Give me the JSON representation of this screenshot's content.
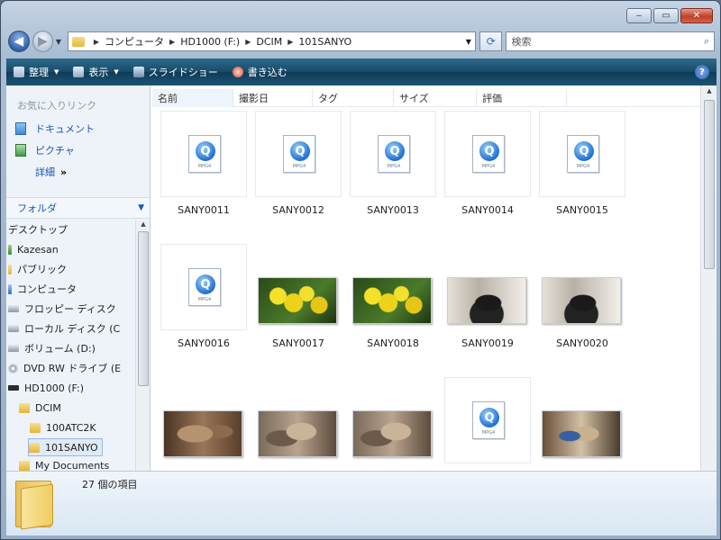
{
  "address": {
    "crumbs": [
      "コンピュータ",
      "HD1000 (F:)",
      "DCIM",
      "101SANYO"
    ]
  },
  "search": {
    "placeholder": "検索"
  },
  "toolbar": {
    "organize": "整理",
    "view": "表示",
    "slideshow": "スライドショー",
    "burn": "書き込む"
  },
  "favorites": {
    "title": "お気に入りリンク",
    "items": [
      "ドキュメント",
      "ピクチャ"
    ],
    "more": "詳細"
  },
  "folders_header": "フォルダ",
  "tree": [
    {
      "label": "デスクトップ",
      "icon": "desktop"
    },
    {
      "label": "Kazesan",
      "icon": "user-folder"
    },
    {
      "label": "パブリック",
      "icon": "folder"
    },
    {
      "label": "コンピュータ",
      "icon": "computer"
    },
    {
      "label": "フロッピー ディスク",
      "icon": "floppy"
    },
    {
      "label": "ローカル ディスク (C",
      "icon": "drive"
    },
    {
      "label": "ボリューム (D:)",
      "icon": "drive"
    },
    {
      "label": "DVD RW ドライブ (E",
      "icon": "dvd"
    },
    {
      "label": "HD1000 (F:)",
      "icon": "drive-black"
    },
    {
      "label": "DCIM",
      "icon": "folder"
    },
    {
      "label": "100ATC2K",
      "icon": "folder"
    },
    {
      "label": "101SANYO",
      "icon": "folder"
    },
    {
      "label": "My Documents",
      "icon": "folder"
    }
  ],
  "columns": [
    "名前",
    "撮影日",
    "タグ",
    "サイズ",
    "評価"
  ],
  "files": [
    {
      "name": "SANY0011",
      "kind": "mpeg"
    },
    {
      "name": "SANY0012",
      "kind": "mpeg"
    },
    {
      "name": "SANY0013",
      "kind": "mpeg"
    },
    {
      "name": "SANY0014",
      "kind": "mpeg"
    },
    {
      "name": "SANY0015",
      "kind": "mpeg"
    },
    {
      "name": "SANY0016",
      "kind": "mpeg"
    },
    {
      "name": "SANY0017",
      "kind": "photo-flowers"
    },
    {
      "name": "SANY0018",
      "kind": "photo-flowers"
    },
    {
      "name": "SANY0019",
      "kind": "photo-cat-dark"
    },
    {
      "name": "SANY0020",
      "kind": "photo-cat-dark"
    },
    {
      "name": "",
      "kind": "photo-cat-brown"
    },
    {
      "name": "",
      "kind": "photo-cat-tabby"
    },
    {
      "name": "",
      "kind": "photo-cat-tabby"
    },
    {
      "name": "",
      "kind": "mpeg"
    },
    {
      "name": "",
      "kind": "photo-cat-mix"
    }
  ],
  "mpeg_label": "MPG4",
  "details": {
    "count_text": "27 個の項目"
  }
}
